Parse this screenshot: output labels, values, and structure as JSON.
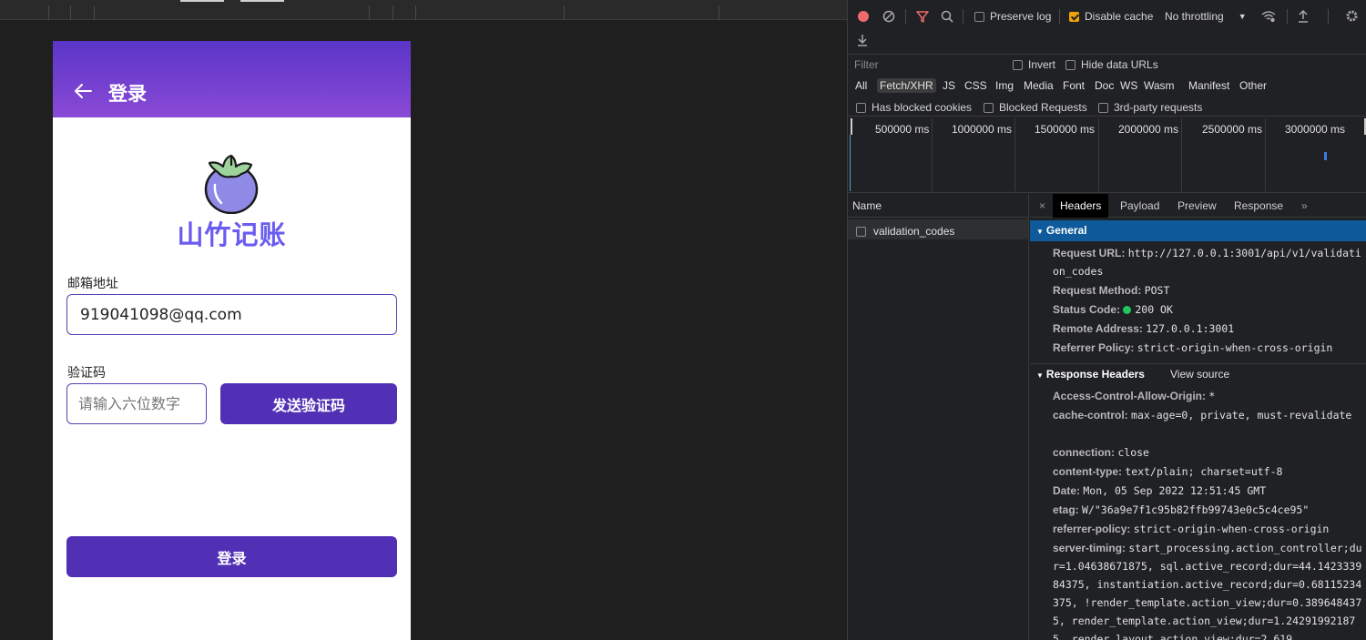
{
  "app": {
    "title": "登录",
    "brand": "山竹记账",
    "email_label": "邮箱地址",
    "email_value": "919041098@qq.com",
    "code_label": "验证码",
    "code_placeholder": "请输入六位数字",
    "send_code_label": "发送验证码",
    "login_label": "登录",
    "colors": {
      "primary": "#5130b5",
      "appbar_top": "#5a35c7",
      "appbar_bottom": "#8a4ad6",
      "brand": "#6a5cf0"
    }
  },
  "devtools": {
    "toolbar": {
      "preserve_log": "Preserve log",
      "disable_cache": "Disable cache",
      "throttling": "No throttling",
      "disable_cache_checked": true
    },
    "filter": {
      "placeholder": "Filter",
      "invert": "Invert",
      "hide_data_urls": "Hide data URLs"
    },
    "types": [
      "All",
      "Fetch/XHR",
      "JS",
      "CSS",
      "Img",
      "Media",
      "Font",
      "Doc",
      "WS",
      "Wasm",
      "Manifest",
      "Other"
    ],
    "active_type": "Fetch/XHR",
    "blocking": {
      "has_blocked_cookies": "Has blocked cookies",
      "blocked_requests": "Blocked Requests",
      "third_party": "3rd-party requests"
    },
    "timeline_labels": [
      "500000 ms",
      "1000000 ms",
      "1500000 ms",
      "2000000 ms",
      "2500000 ms",
      "3000000 ms"
    ],
    "name_header": "Name",
    "request_name": "validation_codes",
    "detail_tabs": [
      "Headers",
      "Payload",
      "Preview",
      "Response"
    ],
    "general": {
      "title": "General",
      "request_url_k": "Request URL:",
      "request_url_v": "http://127.0.0.1:3001/api/v1/validation_codes",
      "method_k": "Request Method:",
      "method_v": "POST",
      "status_k": "Status Code:",
      "status_v": "200 OK",
      "remote_k": "Remote Address:",
      "remote_v": "127.0.0.1:3001",
      "referrer_k": "Referrer Policy:",
      "referrer_v": "strict-origin-when-cross-origin"
    },
    "response_headers": {
      "title": "Response Headers",
      "view_source": "View source",
      "acao_k": "Access-Control-Allow-Origin:",
      "acao_v": "*",
      "cache_k": "cache-control:",
      "cache_v": "max-age=0, private, must-revalidate",
      "conn_k": "connection:",
      "conn_v": "close",
      "ctype_k": "content-type:",
      "ctype_v": "text/plain; charset=utf-8",
      "date_k": "Date:",
      "date_v": "Mon, 05 Sep 2022 12:51:45 GMT",
      "etag_k": "etag:",
      "etag_v": "W/\"36a9e7f1c95b82ffb99743e0c5c4ce95\"",
      "refpol_k": "referrer-policy:",
      "refpol_v": "strict-origin-when-cross-origin",
      "timing_k": "server-timing:",
      "timing_v": "start_processing.action_controller;dur=1.04638671875, sql.active_record;dur=44.142333984375, instantiation.active_record;dur=0.68115234375, !render_template.action_view;dur=0.3896484375, render_template.action_view;dur=1.242919921875, render_layout.action_view;dur=2.619"
    }
  }
}
